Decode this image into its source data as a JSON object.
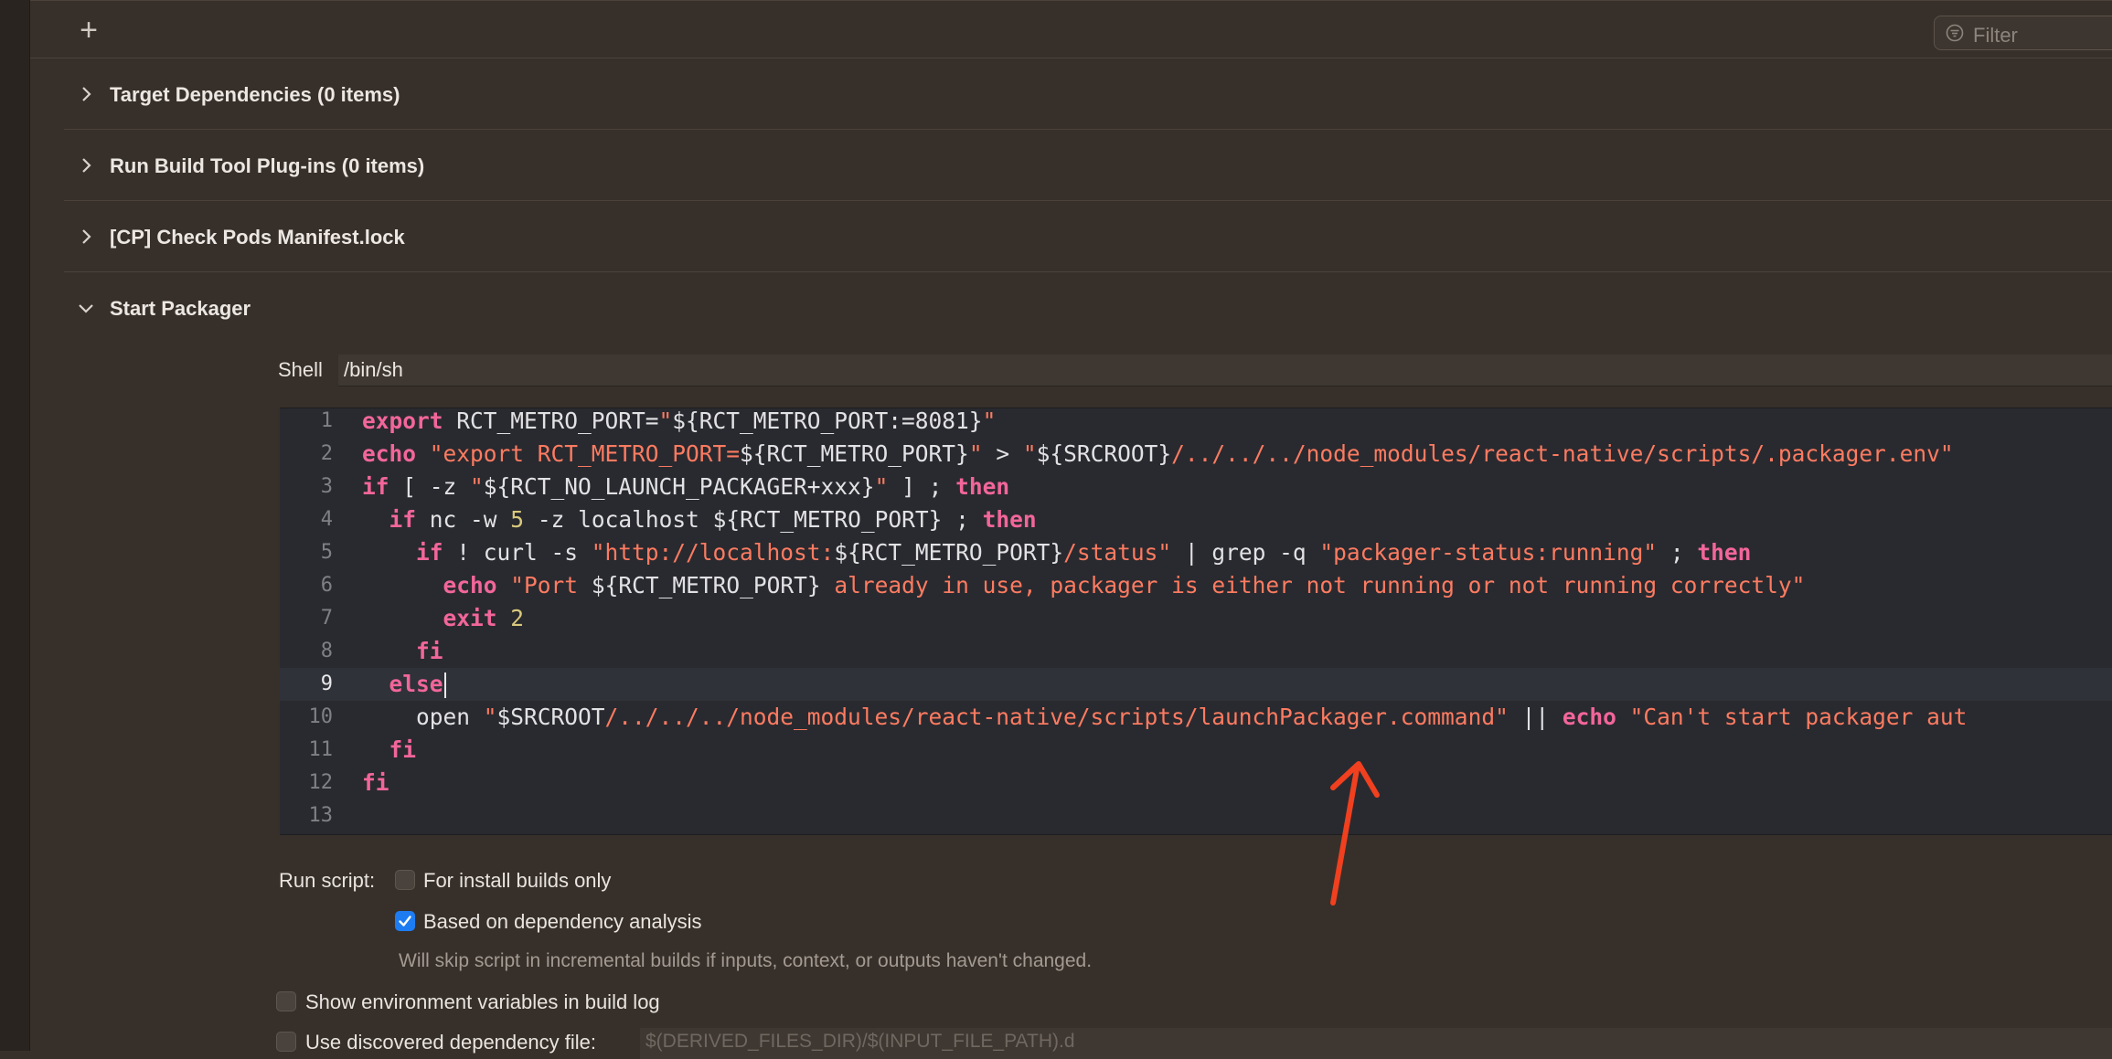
{
  "toolbar": {
    "add_icon": "plus-icon",
    "filter_placeholder": "Filter"
  },
  "phases": [
    {
      "title": "Target Dependencies (0 items)",
      "expanded": false
    },
    {
      "title": "Run Build Tool Plug-ins (0 items)",
      "expanded": false
    },
    {
      "title": "[CP] Check Pods Manifest.lock",
      "expanded": false
    },
    {
      "title": "Start Packager",
      "expanded": true
    }
  ],
  "shell": {
    "label": "Shell",
    "value": "/bin/sh"
  },
  "editor": {
    "line_numbers": [
      "1",
      "2",
      "3",
      "4",
      "5",
      "6",
      "7",
      "8",
      "9",
      "10",
      "11",
      "12",
      "13"
    ],
    "current_line": 9,
    "lines": [
      [
        {
          "t": "kw",
          "v": "export"
        },
        {
          "t": "p",
          "v": " RCT_METRO_PORT="
        },
        {
          "t": "str",
          "v": "\""
        },
        {
          "t": "p",
          "v": "${RCT_METRO_PORT:=8081}"
        },
        {
          "t": "str",
          "v": "\""
        }
      ],
      [
        {
          "t": "kw",
          "v": "echo"
        },
        {
          "t": "p",
          "v": " "
        },
        {
          "t": "str",
          "v": "\"export RCT_METRO_PORT="
        },
        {
          "t": "p",
          "v": "${RCT_METRO_PORT}"
        },
        {
          "t": "str",
          "v": "\""
        },
        {
          "t": "p",
          "v": " > "
        },
        {
          "t": "str",
          "v": "\""
        },
        {
          "t": "p",
          "v": "${SRCROOT}"
        },
        {
          "t": "str",
          "v": "/../../../node_modules/react-native/scripts/.packager.env\""
        }
      ],
      [
        {
          "t": "kw",
          "v": "if"
        },
        {
          "t": "p",
          "v": " [ -z "
        },
        {
          "t": "str",
          "v": "\""
        },
        {
          "t": "p",
          "v": "${RCT_NO_LAUNCH_PACKAGER+xxx}"
        },
        {
          "t": "str",
          "v": "\""
        },
        {
          "t": "p",
          "v": " ] ; "
        },
        {
          "t": "kw",
          "v": "then"
        }
      ],
      [
        {
          "t": "p",
          "v": "  "
        },
        {
          "t": "kw",
          "v": "if"
        },
        {
          "t": "p",
          "v": " nc -w "
        },
        {
          "t": "num",
          "v": "5"
        },
        {
          "t": "p",
          "v": " -z localhost ${RCT_METRO_PORT} ; "
        },
        {
          "t": "kw",
          "v": "then"
        }
      ],
      [
        {
          "t": "p",
          "v": "    "
        },
        {
          "t": "kw",
          "v": "if"
        },
        {
          "t": "p",
          "v": " ! curl -s "
        },
        {
          "t": "str",
          "v": "\"http://localhost:"
        },
        {
          "t": "p",
          "v": "${RCT_METRO_PORT}"
        },
        {
          "t": "str",
          "v": "/status\""
        },
        {
          "t": "p",
          "v": " | grep -q "
        },
        {
          "t": "str",
          "v": "\"packager-status:running\""
        },
        {
          "t": "p",
          "v": " ; "
        },
        {
          "t": "kw",
          "v": "then"
        }
      ],
      [
        {
          "t": "p",
          "v": "      "
        },
        {
          "t": "kw",
          "v": "echo"
        },
        {
          "t": "p",
          "v": " "
        },
        {
          "t": "str",
          "v": "\"Port "
        },
        {
          "t": "p",
          "v": "${RCT_METRO_PORT}"
        },
        {
          "t": "str",
          "v": " already in use, packager is either not running or not running correctly\""
        }
      ],
      [
        {
          "t": "p",
          "v": "      "
        },
        {
          "t": "kw",
          "v": "exit"
        },
        {
          "t": "p",
          "v": " "
        },
        {
          "t": "num",
          "v": "2"
        }
      ],
      [
        {
          "t": "p",
          "v": "    "
        },
        {
          "t": "kw",
          "v": "fi"
        }
      ],
      [
        {
          "t": "p",
          "v": "  "
        },
        {
          "t": "kw",
          "v": "else"
        }
      ],
      [
        {
          "t": "p",
          "v": "    open "
        },
        {
          "t": "str",
          "v": "\""
        },
        {
          "t": "p",
          "v": "$SRCROOT"
        },
        {
          "t": "str",
          "v": "/../../../node_modules/react-native/scripts/launchPackager.command\""
        },
        {
          "t": "p",
          "v": " || "
        },
        {
          "t": "kw",
          "v": "echo"
        },
        {
          "t": "p",
          "v": " "
        },
        {
          "t": "str",
          "v": "\"Can't start packager aut"
        }
      ],
      [
        {
          "t": "p",
          "v": "  "
        },
        {
          "t": "kw",
          "v": "fi"
        }
      ],
      [
        {
          "t": "kw",
          "v": "fi"
        }
      ],
      []
    ]
  },
  "run_script": {
    "label": "Run script:",
    "install_only": {
      "label": "For install builds only",
      "checked": false
    },
    "dependency_analysis": {
      "label": "Based on dependency analysis",
      "checked": true
    },
    "hint": "Will skip script in incremental builds if inputs, context, or outputs haven't changed."
  },
  "show_env": {
    "label": "Show environment variables in build log",
    "checked": false
  },
  "discovered_dep": {
    "label": "Use discovered dependency file:",
    "checked": false,
    "placeholder": "$(DERIVED_FILES_DIR)/$(INPUT_FILE_PATH).d"
  },
  "colors": {
    "keyword": "#f2669a",
    "string": "#fd7b61",
    "number": "#d9c97c",
    "checkbox_on": "#1e7cf2",
    "annotation_arrow": "#f0401f"
  },
  "annotation": {
    "icon": "red-arrow-annotation"
  }
}
